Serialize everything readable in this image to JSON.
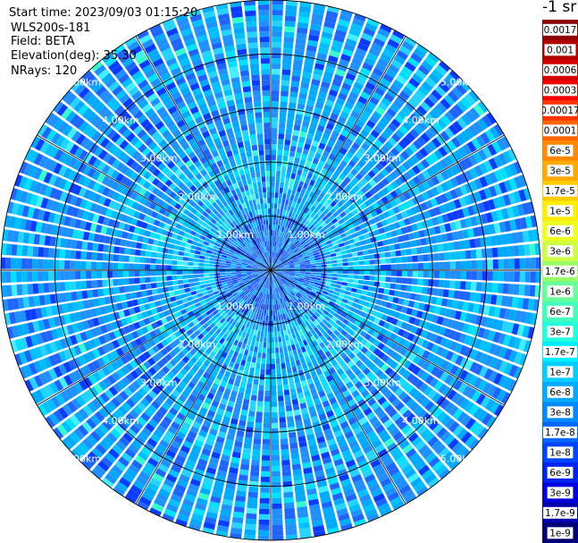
{
  "info": {
    "start_time": "Start time: 2023/09/03 01:15:20",
    "device": "WLS200s-181",
    "field": "Field: BETA",
    "elevation": "Elevation(deg): 35.30",
    "nrays": "NRays: 120"
  },
  "plot": {
    "type": "ppi",
    "n_rays": 120,
    "max_range_km": 5.0,
    "range_rings_km": [
      1.0,
      2.0,
      3.0,
      4.0,
      5.0
    ],
    "ring_labels": [
      "1.00km",
      "2.00km",
      "3.00km",
      "4.00km",
      "5.00km"
    ],
    "spoke_angles_deg": [
      0,
      30,
      60,
      90,
      120,
      150,
      180,
      210,
      240,
      270,
      300,
      330
    ],
    "label_angles_deg": [
      45,
      135,
      225,
      315
    ],
    "colors": {
      "grid": "#000000",
      "ray_gap": "#ffffff",
      "labels": "#ffffff"
    }
  },
  "colorbar": {
    "unit": "-1 sr",
    "labels": [
      "0.0017",
      "0.001",
      "0.0006",
      "0.0003",
      "0.00017",
      "0.0001",
      "6e-5",
      "3e-5",
      "1.7e-5",
      "1e-5",
      "6e-6",
      "3e-6",
      "1.7e-6",
      "1e-6",
      "6e-7",
      "3e-7",
      "1.7e-7",
      "1e-7",
      "6e-8",
      "3e-8",
      "1.7e-8",
      "1e-8",
      "6e-9",
      "3e-9",
      "1.7e-9",
      "1e-9"
    ],
    "colors": [
      "#8b0000",
      "#b00000",
      "#d40000",
      "#f00000",
      "#ff3300",
      "#ff6600",
      "#ff8800",
      "#ffaa00",
      "#ffcc00",
      "#ffee00",
      "#eeff22",
      "#ccff44",
      "#99ff66",
      "#66ff99",
      "#44ffbb",
      "#22ffdd",
      "#00eeff",
      "#00ccff",
      "#00aaff",
      "#0088ff",
      "#0066ff",
      "#0044ff",
      "#0022ee",
      "#0000dd",
      "#0000aa",
      "#000077"
    ]
  }
}
